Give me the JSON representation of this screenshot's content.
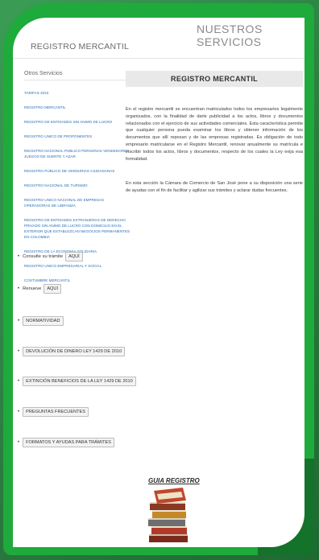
{
  "header": {
    "title": "NUESTROS SERVICIOS",
    "subtitle": "REGISTRO MERCANTIL"
  },
  "sidebar": {
    "heading": "Otros Servicios",
    "items": [
      "TARIFAS 2010",
      "REGISTRO MERCANTIL",
      "REGISTRO DE ENTIDADES SIN ANIMO DE LUCRO",
      "REGISTRO UNICO DE PROPONENTES",
      "REGISTRO NACIONAL PÚBLICO PERSONAS VENDEDORES JUEGOS DE SUERTE Y AZAR",
      "REGISTRO PÚBLICO DE VEEDURIAS CIUDADANAS",
      "REGISTRO NACIONAL DE TURISMO",
      "REGISTRO UNICO NACIONAL DE EMPRESAS OPERADORAS DE LIBRANZA",
      "REGISTRO DE ENTIDADES EXTRANJERAS DE DERECHO PRIVADO SIN ANIMO DE LUCRO CON DOMICILIO EN EL EXTERIOR QUE ESTABLEZCAN NEGOCIOS PERMANENTES EN COLOMBIA",
      "REGISTRO DE LA ECONOMIA SOLIDARIA",
      "REGISTRO UNICO EMPRESARIAL Y SOCIAL",
      "COSTUMBRE MERCANTIL"
    ]
  },
  "main": {
    "heading": "REGISTRO MERCANTIL",
    "paragraph1": "En el registro mercantil se encuentran matriculados todos los empresarios legalmente organizados, con la finalidad de darle publicidad a los actos, libros y documentos relacionados con el ejercicio de sus actividades comerciales. Esta característica permite que cualquier persona pueda examinar los libros y obtener información de los documentos que allí reposan y de las empresas registradas. Es obligación de todo empresario matricularse en el Registro Mercantil, renovar anualmente su matrícula e inscribir todos los actos, libros y documentos, respecto de los cuales la Ley exija esa formalidad.",
    "paragraph2": "En esta sección la Cámara de Comercio de San José pone a su disposición una serie de ayudas con el fin de facilitar y agilizar sus trámites y aclarar dudas frecuentes.",
    "links": [
      {
        "text": "Consulte su trámite",
        "button": "AQUÍ"
      },
      {
        "text": "Renueve",
        "button": "AQUÍ"
      },
      {
        "text": "",
        "button": "NORMATIVIDAD"
      },
      {
        "text": "",
        "button": "DEVOLUCIÓN DE DINERO LEY 1429 DE 2010"
      },
      {
        "text": "",
        "button": "EXTINCIÓN BENEFICIOS DE LA LEY 1429 DE 2010"
      },
      {
        "text": "",
        "button": "PREGUNTAS FRECUENTES"
      },
      {
        "text": "",
        "button": "FORMATOS Y AYUDAS PARA TRÁMITES"
      }
    ],
    "guide_label": "GUIA REGISTRO",
    "bullet": "•"
  },
  "colors": {
    "frame_green": "#1faa3c",
    "link_blue": "#2a6fb5"
  }
}
